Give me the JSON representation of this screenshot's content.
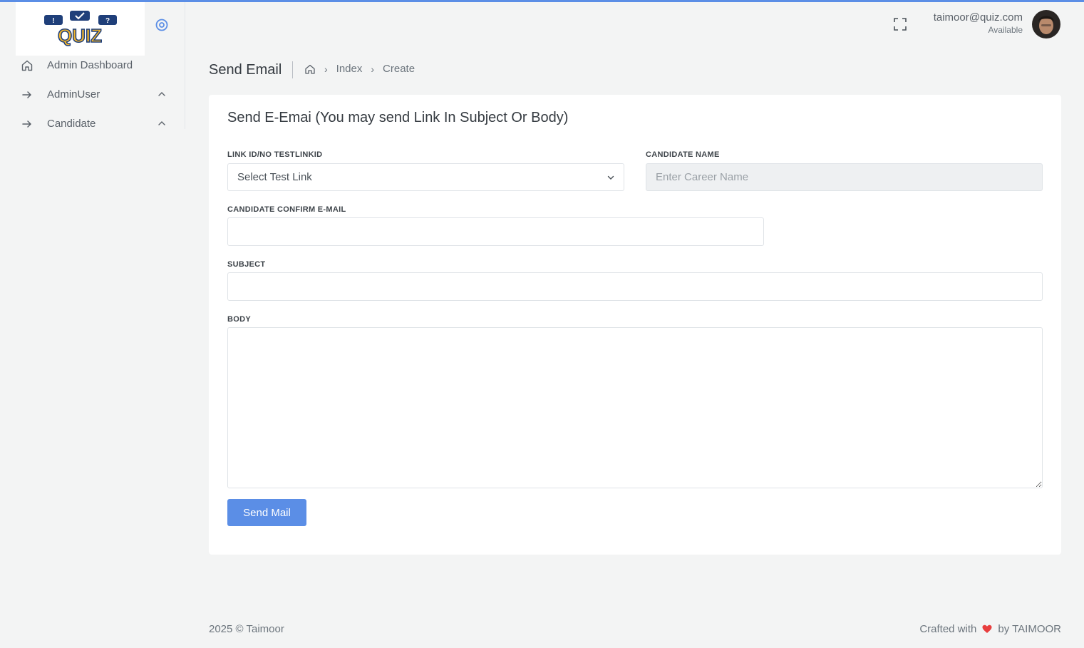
{
  "app": {
    "logo_text": "QUIZ"
  },
  "sidebar": {
    "items": [
      {
        "label": "Admin Dashboard",
        "icon": "home-icon",
        "has_submenu": false
      },
      {
        "label": "AdminUser",
        "icon": "arrow-right-icon",
        "has_submenu": true
      },
      {
        "label": "Candidate",
        "icon": "arrow-right-icon",
        "has_submenu": true
      }
    ]
  },
  "topbar": {
    "user_email": "taimoor@quiz.com",
    "user_status": "Available"
  },
  "page": {
    "title": "Send Email",
    "breadcrumb": [
      "Index",
      "Create"
    ]
  },
  "form": {
    "title": "Send E-Emai (You may send Link In Subject Or Body)",
    "link_label": "LINK ID/NO TESTLINKID",
    "link_selected": "Select Test Link",
    "candidate_name_label": "CANDIDATE NAME",
    "candidate_name_placeholder": "Enter Career Name",
    "confirm_email_label": "CANDIDATE CONFIRM E-MAIL",
    "confirm_email_value": "",
    "subject_label": "SUBJECT",
    "subject_value": "",
    "body_label": "BODY",
    "body_value": "",
    "submit_label": "Send Mail"
  },
  "footer": {
    "copyright": "2025 © Taimoor",
    "crafted_prefix": "Crafted with",
    "crafted_suffix": "by TAIMOOR"
  },
  "colors": {
    "accent": "#5b8ee6",
    "heart": "#e83e3e",
    "background": "#f3f4f4"
  }
}
